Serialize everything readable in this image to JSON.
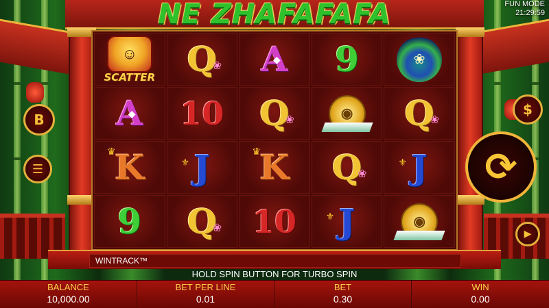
{
  "title": "NE ZHAFAFAFA",
  "status": {
    "mode": "FUN MODE",
    "time": "21:29:59"
  },
  "reels": [
    [
      "SCATTER",
      "Q",
      "A",
      "9",
      "PEACOCK"
    ],
    [
      "A",
      "10",
      "Q",
      "COIN",
      "Q"
    ],
    [
      "K",
      "J",
      "K",
      "Q",
      "J"
    ],
    [
      "9",
      "Q",
      "10",
      "J",
      "COIN"
    ]
  ],
  "scatter_label": "SCATTER",
  "buttons": {
    "b_label": "B",
    "dollar_label": "$"
  },
  "wintrack_label": "WINTRACK™",
  "hint": "HOLD SPIN BUTTON FOR TURBO SPIN",
  "stats": {
    "balance_label": "BALANCE",
    "balance_value": "10,000.00",
    "bet_per_line_label": "BET PER LINE",
    "bet_per_line_value": "0.01",
    "bet_label": "BET",
    "bet_value": "0.30",
    "win_label": "WIN",
    "win_value": "0.00"
  }
}
